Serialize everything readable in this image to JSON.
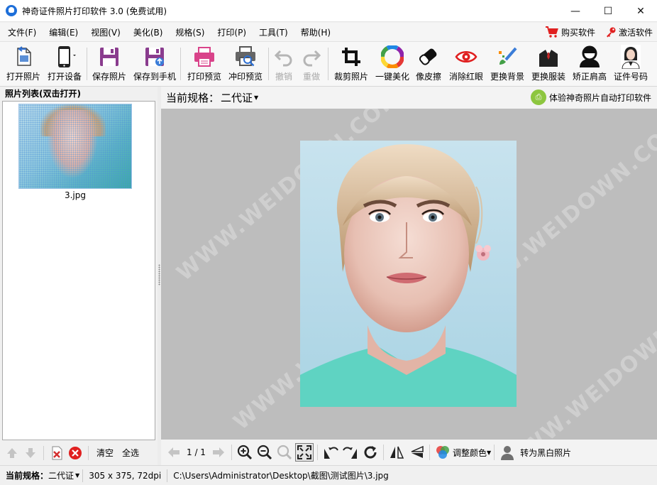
{
  "window": {
    "title": "神奇证件照片打印软件 3.0 (免费试用)",
    "controls": {
      "minimize": "—",
      "maximize": "☐",
      "close": "✕"
    }
  },
  "menu": {
    "items": [
      "文件(F)",
      "编辑(E)",
      "视图(V)",
      "美化(B)",
      "规格(S)",
      "打印(P)",
      "工具(T)",
      "帮助(H)"
    ],
    "buy": "购买软件",
    "activate": "激活软件"
  },
  "toolbar": {
    "open_photo": "打开照片",
    "open_device": "打开设备",
    "save_photo": "保存照片",
    "save_to_phone": "保存到手机",
    "print_preview": "打印预览",
    "develop_preview": "冲印预览",
    "undo": "撤销",
    "redo": "重做",
    "crop": "裁剪照片",
    "beautify": "一键美化",
    "eraser": "像皮擦",
    "red_eye": "消除红眼",
    "change_bg": "更换背景",
    "change_clothes": "更换服装",
    "fix_shoulder": "矫正肩高",
    "id_number": "证件号码"
  },
  "photo_list": {
    "title": "照片列表(双击打开)",
    "items": [
      {
        "name": "3.jpg"
      }
    ],
    "clear": "清空",
    "select_all": "全选"
  },
  "main": {
    "spec_label": "当前规格：",
    "spec_value": "二代证",
    "experience_link": "体验神奇照片自动打印软件",
    "watermark": "WWW.WEIDOWN.COM"
  },
  "bottom_tools": {
    "page": "1 / 1",
    "adjust_color": "调整颜色",
    "to_bw": "转为黑白照片"
  },
  "status": {
    "spec_label": "当前规格：",
    "spec_value": "二代证",
    "dimensions": "305 x 375, 72dpi",
    "path": "C:\\Users\\Administrator\\Desktop\\截图\\测试图片\\3.jpg"
  },
  "colors": {
    "title_icon": "#1e6fd9",
    "canvas_bg": "#bdbdbd",
    "accent_red": "#e02020",
    "save_purple": "#8a3c8e",
    "print_pink": "#d9438a",
    "teal_shirt": "#5fd3c2"
  }
}
